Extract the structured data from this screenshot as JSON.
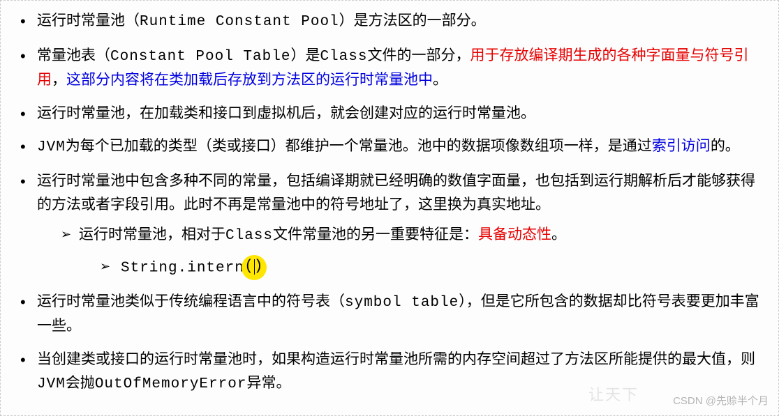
{
  "bullets": [
    {
      "segments": [
        {
          "text": "运行时常量池（",
          "cls": ""
        },
        {
          "text": "Runtime Constant Pool",
          "cls": "mono"
        },
        {
          "text": "）是方法区的一部分。",
          "cls": ""
        }
      ]
    },
    {
      "segments": [
        {
          "text": "常量池表（",
          "cls": ""
        },
        {
          "text": "Constant Pool Table",
          "cls": "mono"
        },
        {
          "text": "）是",
          "cls": ""
        },
        {
          "text": "Class",
          "cls": "mono"
        },
        {
          "text": "文件的一部分，",
          "cls": ""
        },
        {
          "text": "用于存放编译期生成的各种字面量与符号引用",
          "cls": "red"
        },
        {
          "text": "，",
          "cls": ""
        },
        {
          "text": "这部分内容将在类加载后存放到方法区的运行时常量池中",
          "cls": "blue"
        },
        {
          "text": "。",
          "cls": ""
        }
      ]
    },
    {
      "segments": [
        {
          "text": "运行时常量池，在加载类和接口到虚拟机后，就会创建对应的运行时常量池。",
          "cls": ""
        }
      ]
    },
    {
      "segments": [
        {
          "text": "JVM",
          "cls": "mono"
        },
        {
          "text": "为每个已加载的类型（类或接口）都维护一个常量池。池中的数据项像数组项一样，是通过",
          "cls": ""
        },
        {
          "text": "索引访问",
          "cls": "blue"
        },
        {
          "text": "的。",
          "cls": ""
        }
      ]
    },
    {
      "segments": [
        {
          "text": "运行时常量池中包含多种不同的常量，包括编译期就已经明确的数值字面量，也包括到运行期解析后才能够获得的方法或者字段引用。此时不再是常量池中的符号地址了，这里换为真实地址。",
          "cls": ""
        }
      ],
      "sub": [
        {
          "segments": [
            {
              "text": "运行时常量池，相对于",
              "cls": ""
            },
            {
              "text": "Class",
              "cls": "mono"
            },
            {
              "text": "文件常量池的另一重要特征是：",
              "cls": ""
            },
            {
              "text": "具备动态性",
              "cls": "red"
            },
            {
              "text": "。",
              "cls": ""
            }
          ],
          "subsub": [
            {
              "code_prefix": "String.intern",
              "code_highlight": "()"
            }
          ]
        }
      ]
    },
    {
      "segments": [
        {
          "text": "运行时常量池类似于传统编程语言中的符号表（",
          "cls": ""
        },
        {
          "text": "symbol table",
          "cls": "mono"
        },
        {
          "text": "），但是它所包含的数据却比符号表要更加丰富一些。",
          "cls": ""
        }
      ]
    },
    {
      "segments": [
        {
          "text": "当创建类或接口的运行时常量池时，如果构造运行时常量池所需的内存空间超过了方法区所能提供的最大值，则",
          "cls": ""
        },
        {
          "text": "JVM",
          "cls": "mono"
        },
        {
          "text": "会抛",
          "cls": ""
        },
        {
          "text": "OutOfMemoryError",
          "cls": "mono"
        },
        {
          "text": "异常。",
          "cls": ""
        }
      ]
    }
  ],
  "watermark_main": "CSDN @先赊半个月",
  "watermark_faint": "让天下"
}
